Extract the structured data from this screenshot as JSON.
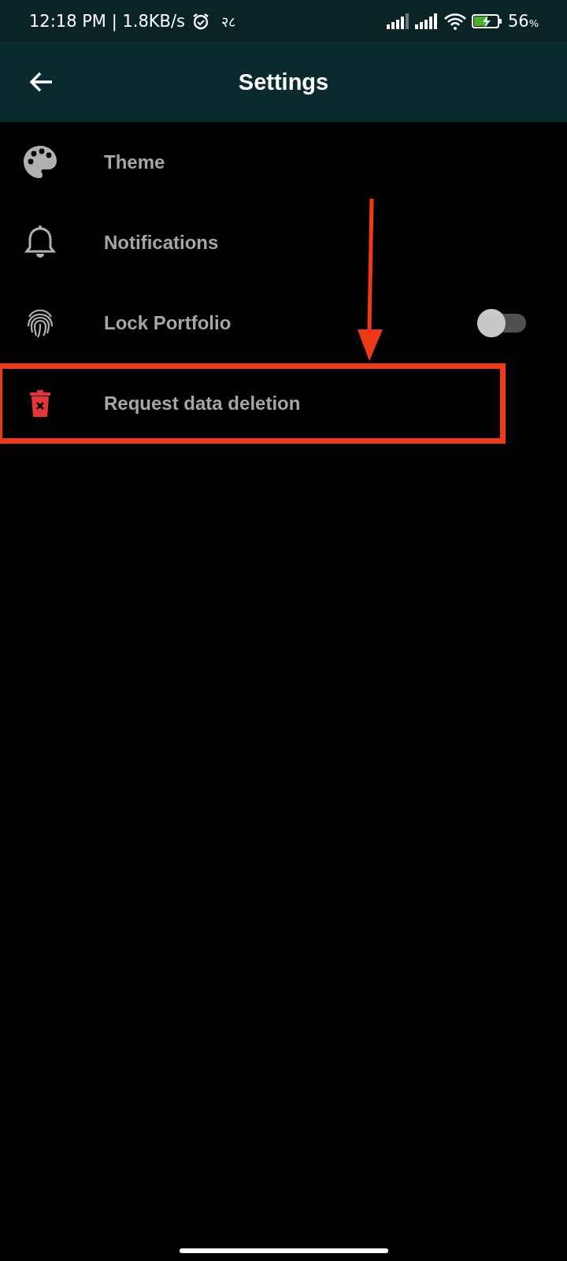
{
  "status_bar": {
    "time": "12:18 PM | 1.8KB/s",
    "extra": "२८",
    "battery": "56",
    "battery_unit": "%"
  },
  "header": {
    "title": "Settings"
  },
  "items": [
    {
      "label": "Theme",
      "kind": "link"
    },
    {
      "label": "Notifications",
      "kind": "link"
    },
    {
      "label": "Lock Portfolio",
      "kind": "toggle",
      "on": false
    },
    {
      "label": "Request data deletion",
      "kind": "link"
    }
  ]
}
